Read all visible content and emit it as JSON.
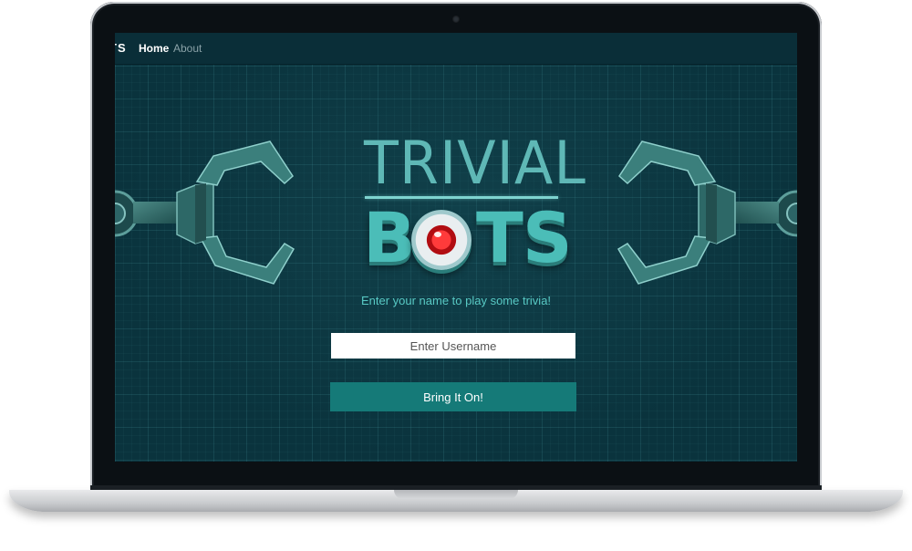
{
  "navbar": {
    "brand": "TS",
    "links": [
      {
        "label": "Home",
        "active": true
      },
      {
        "label": "About",
        "active": false
      }
    ]
  },
  "logo": {
    "line1": "TRIVIAL",
    "line2_left": "B",
    "line2_right": "TS",
    "eye_color": "#ff3b3b"
  },
  "hero": {
    "tagline": "Enter your name to play some trivia!"
  },
  "form": {
    "username_placeholder": "Enter Username",
    "username_value": "",
    "submit_label": "Bring It On!"
  },
  "colors": {
    "accent": "#157a78",
    "background": "#0a333d",
    "logo": "#4bbdb8",
    "tagline": "#58c9c4"
  },
  "icons": [
    "robot-eye-icon",
    "left-claw-icon",
    "right-claw-icon"
  ]
}
